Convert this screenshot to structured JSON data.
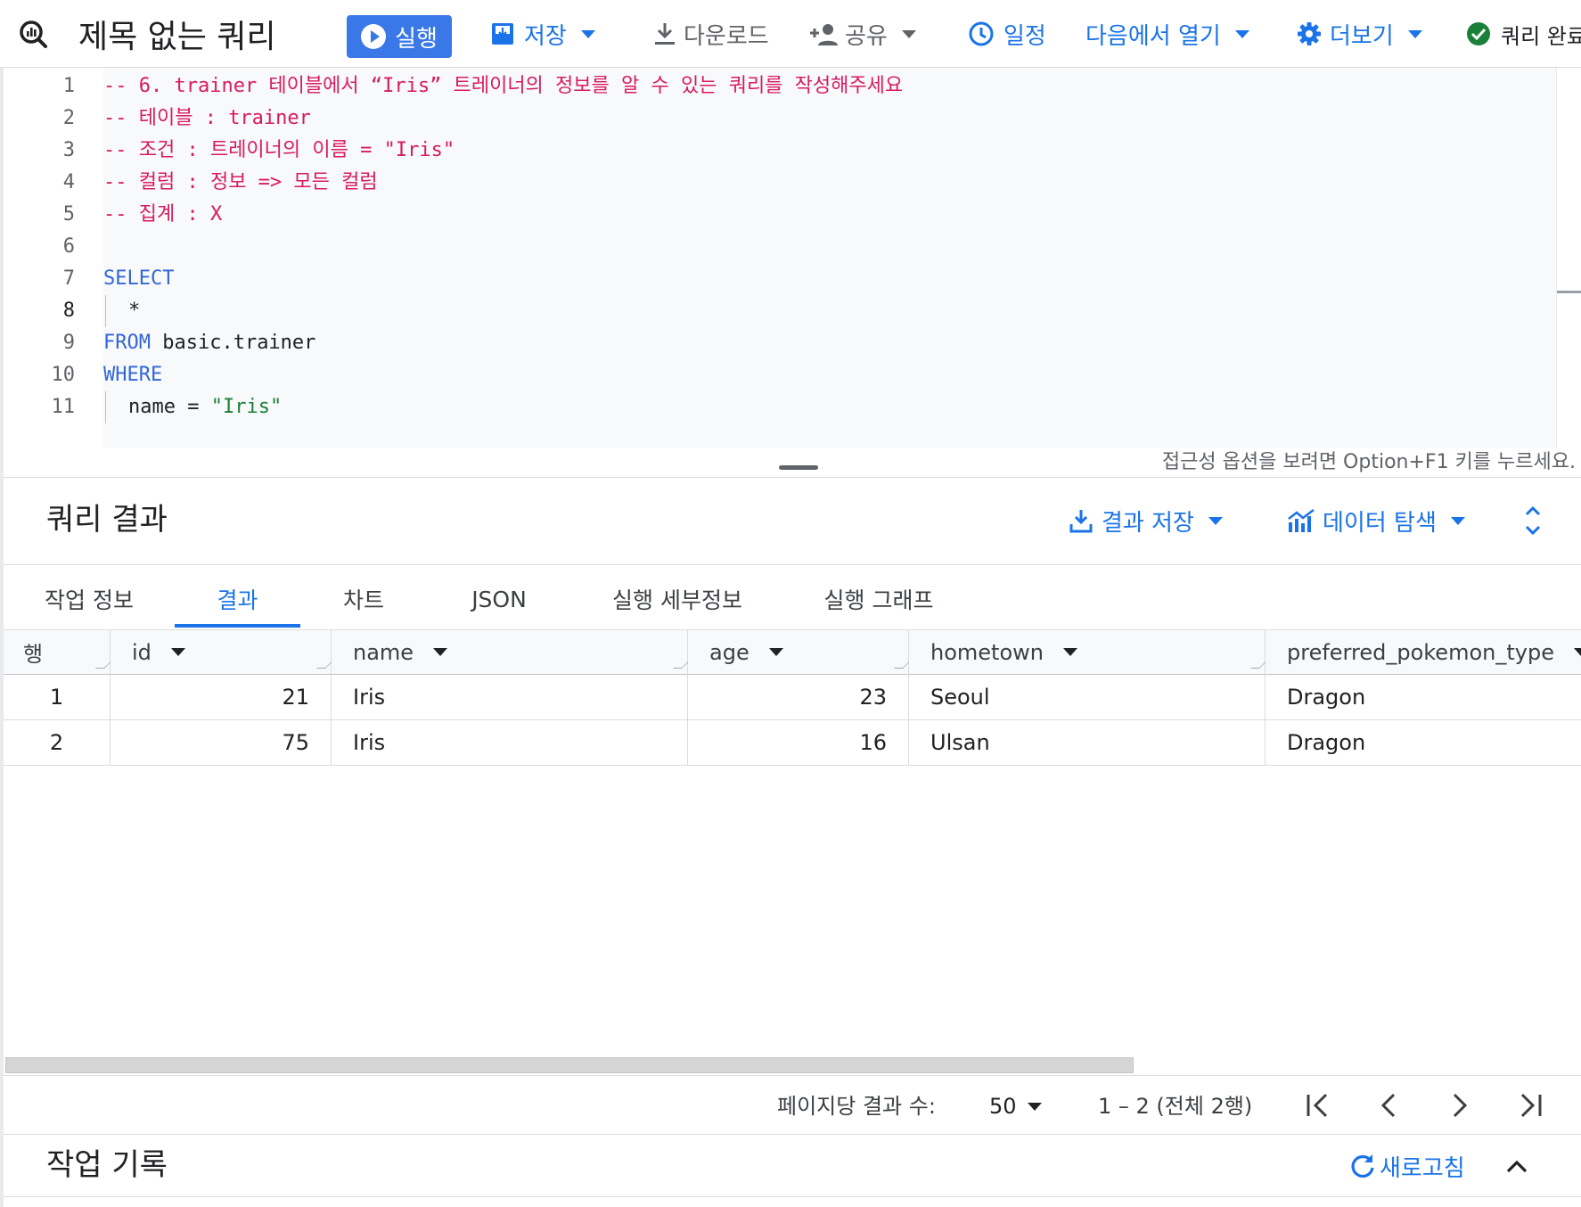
{
  "app": {
    "title": "제목 없는 쿼리"
  },
  "toolbar": {
    "run": "실행",
    "save": "저장",
    "download": "다운로드",
    "share": "공유",
    "schedule": "일정",
    "open_in": "다음에서 열기",
    "more": "더보기",
    "status": "쿼리 완료"
  },
  "editor": {
    "line_numbers": [
      "1",
      "2",
      "3",
      "4",
      "5",
      "6",
      "7",
      "8",
      "9",
      "10",
      "11"
    ],
    "active_line": "8",
    "lines": {
      "l1": "-- 6. trainer 테이블에서 “Iris” 트레이너의 정보를 알 수 있는 쿼리를 작성해주세요",
      "l2": "-- 테이블 : trainer",
      "l3": "-- 조건 : 트레이너의 이름 = \"Iris\"",
      "l4": "-- 컬럼 : 정보 => 모든 컬럼",
      "l5": "-- 집계 : X",
      "l7_kw": "SELECT",
      "l8_txt": "*",
      "l9_kw": "FROM",
      "l9_txt": " basic.trainer",
      "l10_kw": "WHERE",
      "l11_txt": "name = ",
      "l11_str": "\"Iris\""
    },
    "a11y_hint": "접근성 옵션을 보려면 Option+F1 키를 누르세요."
  },
  "results": {
    "title": "쿼리 결과",
    "save_results": "결과 저장",
    "explore_data": "데이터 탐색",
    "tabs": [
      "작업 정보",
      "결과",
      "차트",
      "JSON",
      "실행 세부정보",
      "실행 그래프"
    ],
    "active_tab": "결과",
    "row_header": "행",
    "columns": [
      "id",
      "name",
      "age",
      "hometown",
      "preferred_pokemon_type"
    ],
    "rows": [
      {
        "row": "1",
        "id": "21",
        "name": "Iris",
        "age": "23",
        "hometown": "Seoul",
        "preferred_pokemon_type": "Dragon"
      },
      {
        "row": "2",
        "id": "75",
        "name": "Iris",
        "age": "16",
        "hometown": "Ulsan",
        "preferred_pokemon_type": "Dragon"
      }
    ]
  },
  "pagination": {
    "per_page_label": "페이지당 결과 수:",
    "per_page_value": "50",
    "range": "1 – 2 (전체 2행)"
  },
  "job_history": {
    "title": "작업 기록",
    "refresh": "새로고침"
  },
  "colors": {
    "accent": "#1a73e8",
    "run_button": "#3b78e7",
    "comment": "#d81b60",
    "keyword": "#3367d6",
    "string": "#188038",
    "success": "#188038"
  },
  "icons": {
    "logo": "bigquery-icon",
    "run": "play-icon",
    "save": "save-icon",
    "download": "download-icon",
    "share": "person-add-icon",
    "schedule": "clock-icon",
    "more": "gear-icon",
    "status": "check-circle-icon",
    "save_results": "download-icon",
    "explore_data": "chart-icon",
    "expand": "expand-icon",
    "first_page": "first-page-icon",
    "prev_page": "chevron-left-icon",
    "next_page": "chevron-right-icon",
    "last_page": "last-page-icon",
    "refresh": "refresh-icon",
    "collapse": "chevron-up-icon"
  }
}
